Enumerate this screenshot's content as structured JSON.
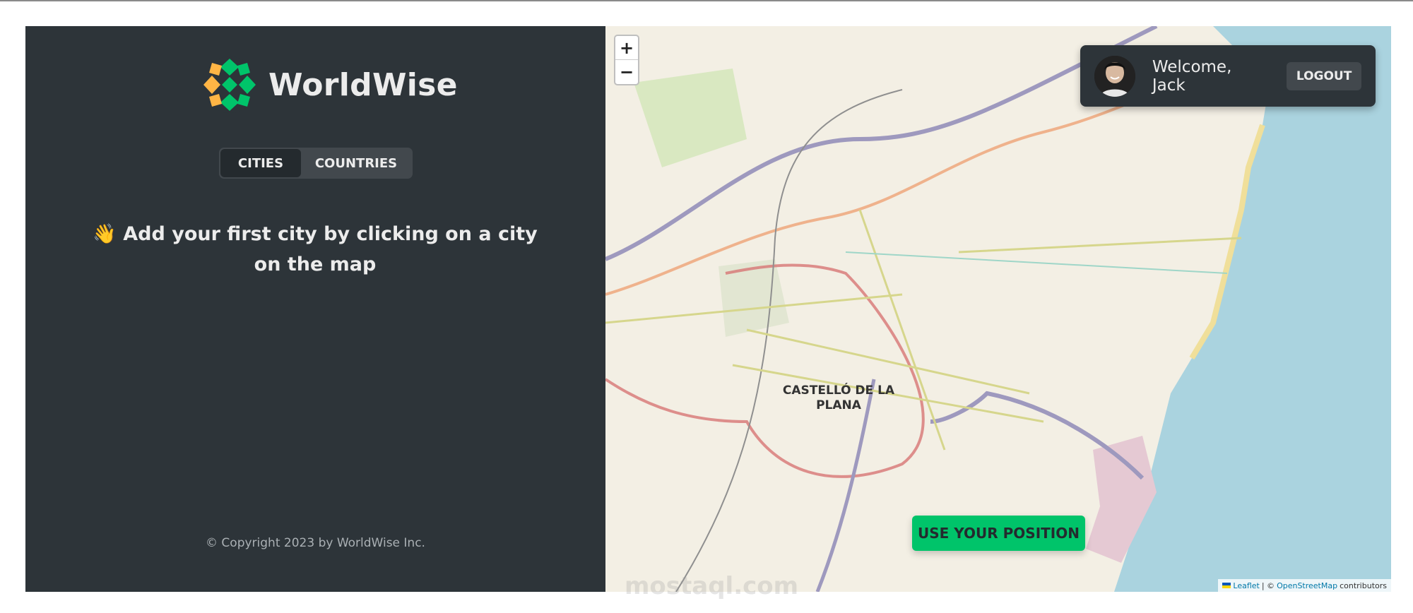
{
  "app": {
    "name": "WorldWise"
  },
  "tabs": [
    {
      "label": "CITIES",
      "active": true
    },
    {
      "label": "COUNTRIES",
      "active": false
    }
  ],
  "message": {
    "emoji": "👋",
    "text": "Add your first city by clicking on a city on the map"
  },
  "footer": {
    "copyright": "© Copyright 2023 by WorldWise Inc."
  },
  "map": {
    "zoom_in": "+",
    "zoom_out": "−",
    "city_label": "CASTELLÓ DE LA PLANA",
    "use_position": "USE YOUR POSITION",
    "attribution": {
      "leaflet": "Leaflet",
      "separator": "| ©",
      "osm": "OpenStreetMap",
      "suffix": "contributors"
    }
  },
  "user": {
    "welcome": "Welcome, Jack",
    "logout": "LOGOUT"
  },
  "watermark": "mostaql.com",
  "colors": {
    "sidebar": "#2d3439",
    "accent": "#00c46a",
    "text": "#ececec",
    "sea": "#aad3df"
  }
}
